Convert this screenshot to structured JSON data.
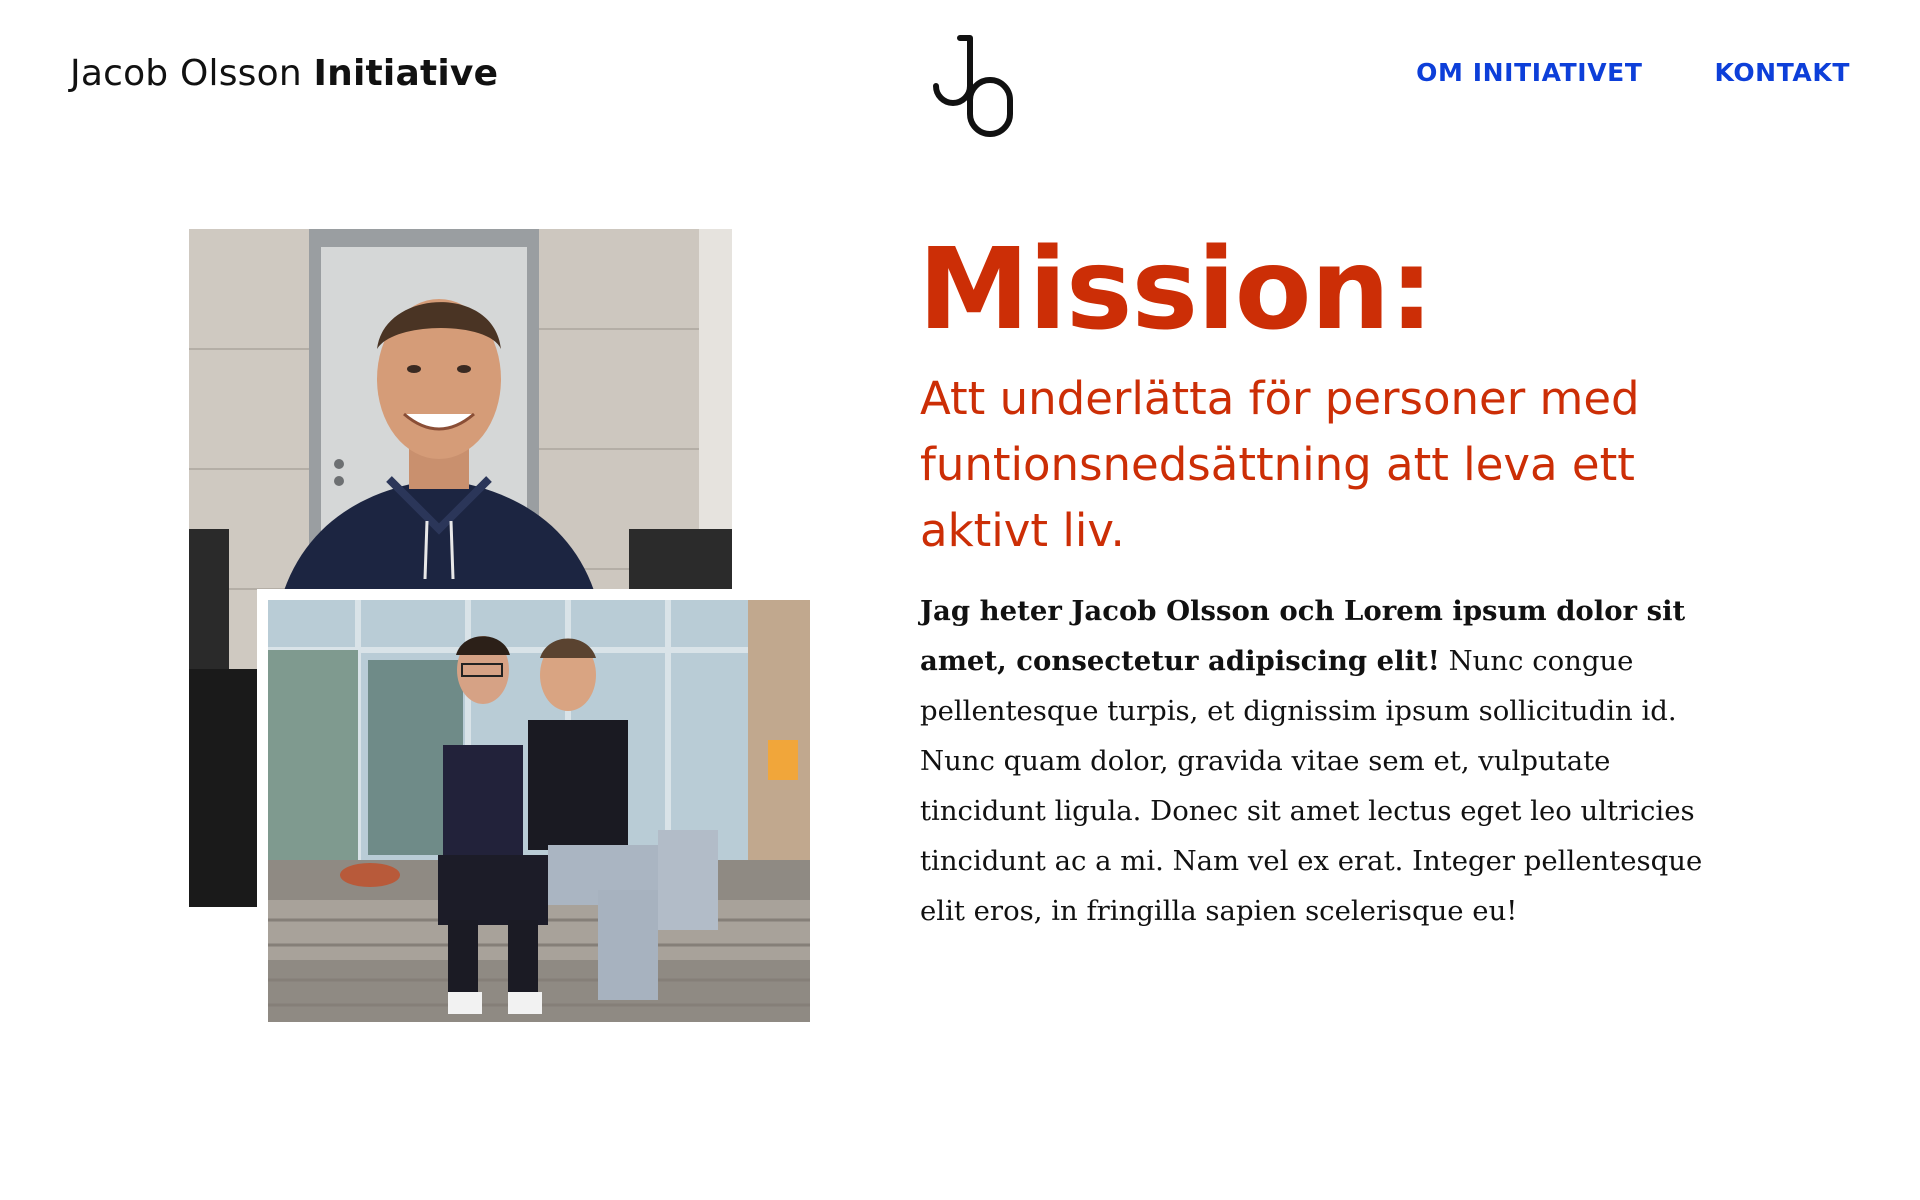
{
  "header": {
    "title_regular": "Jacob Olsson",
    "title_bold": "Initiative",
    "logo_icon": "jo-monogram-logo-icon"
  },
  "nav": {
    "items": [
      {
        "label": "OM INITIATIVET"
      },
      {
        "label": "KONTAKT"
      }
    ]
  },
  "photos": {
    "back": "portrait-photo",
    "front": "friends-photo"
  },
  "mission": {
    "heading": "Mission:",
    "subheading": "Att underlätta för personer med funtionsnedsättning att leva ett aktivt liv.",
    "intro_bold": "Jag heter Jacob Olsson och Lorem ipsum dolor sit amet, consectetur adipiscing elit!",
    "body": " Nunc congue pellentesque turpis, et dignissim ipsum sollicitudin id. Nunc quam dolor, gravida vitae sem et, vulputate tincidunt ligula. Donec sit amet lectus eget leo ultricies tincidunt ac a mi. Nam vel ex erat. Integer pellentesque elit eros, in fringilla sapien scelerisque eu!"
  },
  "colors": {
    "accent": "#cc2e06",
    "link": "#0d3fd9",
    "text": "#111111",
    "background": "#ffffff"
  }
}
